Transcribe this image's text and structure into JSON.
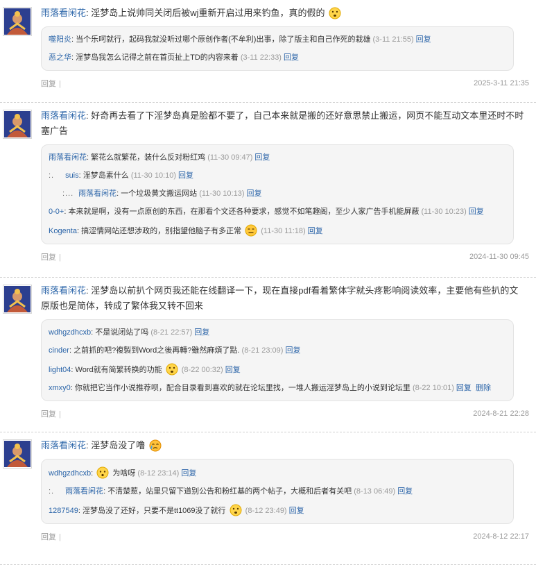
{
  "threads": [
    {
      "author": "雨落看闲花",
      "sep": ":",
      "text": "淫梦岛上说帅同关闭后被wj重新开启过用来钓鱼，真的假的",
      "emoji": "doubt-face",
      "replies": [
        {
          "author": "噬阳炎",
          "sep": ":",
          "text": "当个乐呵就行，起码我就没听过哪个原创作者(不牟利)出事，除了版主和自己作死的栽雄",
          "time": "(3-11 21:55)",
          "reply_label": "回复"
        },
        {
          "author": "恶之华",
          "sep": ":",
          "text": "淫梦岛我怎么记得之前在首页扯上TD的内容来着",
          "time": "(3-11 22:33)",
          "reply_label": "回复"
        }
      ],
      "foot_reply": "回复",
      "foot_bar": "|",
      "date": "2025-3-11 21:35"
    },
    {
      "author": "雨落看闲花",
      "sep": ":",
      "text": "好奇再去看了下淫梦岛真是脸都不要了，自己本来就是搬的还好意思禁止搬运，网页不能互动文本里还时不时塞广告",
      "replies": [
        {
          "author": "雨落看闲花",
          "sep": ":",
          "text": "繁花么就繁花，装什么反对粉红鸡",
          "time": "(11-30 09:47)",
          "reply_label": "回复"
        },
        {
          "prefix": ":.",
          "author": "suis",
          "sep": ":",
          "text": "淫梦岛素什么",
          "time": "(11-30 10:10)",
          "reply_label": "回复"
        },
        {
          "prefix": ":...",
          "author": "雨落看闲花",
          "sep": ":",
          "text": "一个垃圾黄文搬运网站",
          "time": "(11-30 10:13)",
          "reply_label": "回复"
        },
        {
          "author": "0-0+",
          "sep": ":",
          "text": "本来就是啊，没有一点原创的东西，在那看个文还各种要求，感觉不如笔趣阁，至少人家广告手机能屏蔽",
          "time": "(11-30 10:23)",
          "reply_label": "回复"
        },
        {
          "author": "Kogenta",
          "sep": ":",
          "text": "搞涩情网站还想涉政的，别指望他脑子有多正常",
          "emoji": "meh-face",
          "time": "(11-30 11:18)",
          "reply_label": "回复"
        }
      ],
      "foot_reply": "回复",
      "foot_bar": "|",
      "date": "2024-11-30 09:45"
    },
    {
      "author": "雨落看闲花",
      "sep": ":",
      "text": "淫梦岛以前扒个网页我还能在线翻译一下，现在直接pdf看着繁体字就头疼影响阅读效率，主要他有些扒的文原版也是简体，转成了繁体我又转不回来",
      "replies": [
        {
          "author": "wdhgzdhcxb",
          "sep": ":",
          "text": "不是说闭站了吗",
          "time": "(8-21 22:57)",
          "reply_label": "回复"
        },
        {
          "author": "cinder",
          "sep": ":",
          "text": "之前抓的吧?複製到Word之後再轉?雖然麻煩了點.",
          "time": "(8-21 23:09)",
          "reply_label": "回复"
        },
        {
          "author": "light04",
          "sep": ":",
          "text": "Word就有简繁转换的功能",
          "emoji": "doubt-face",
          "time": "(8-22 00:32)",
          "reply_label": "回复"
        },
        {
          "author": "xmxy0",
          "sep": ":",
          "text": "你就把它当作小说推荐呗，配合目录看到喜欢的就在论坛里找，一堆人搬运淫梦岛上的小说到论坛里",
          "time": "(8-22 10:01)",
          "reply_label": "回复",
          "delete_label": "删除"
        }
      ],
      "foot_reply": "回复",
      "foot_bar": "|",
      "date": "2024-8-21 22:28"
    },
    {
      "author": "雨落看闲花",
      "sep": ":",
      "text": "淫梦岛没了噜",
      "emoji": "cry-face",
      "replies": [
        {
          "author": "wdhgzdhcxb",
          "sep": ":",
          "emoji_before": "sad-face",
          "text": "为啥呀",
          "time": "(8-12 23:14)",
          "reply_label": "回复"
        },
        {
          "prefix": ":.",
          "author": "雨落看闲花",
          "sep": ":",
          "text": "不清楚惹，站里只留下道别公告和粉红基的两个帖子，大概和后者有关吧",
          "time": "(8-13 06:49)",
          "reply_label": "回复"
        },
        {
          "author": "1287549",
          "sep": ":",
          "text": "淫梦岛没了还好，只要不是tt1069没了就行",
          "emoji": "doubt-face",
          "time": "(8-12 23:49)",
          "reply_label": "回复"
        }
      ],
      "foot_reply": "回复",
      "foot_bar": "|",
      "date": "2024-8-12 22:17"
    }
  ],
  "colors": {
    "link": "#2a64a8",
    "muted": "#999999",
    "reply_bg": "#f5f5f5",
    "border": "#e3e3e3"
  }
}
